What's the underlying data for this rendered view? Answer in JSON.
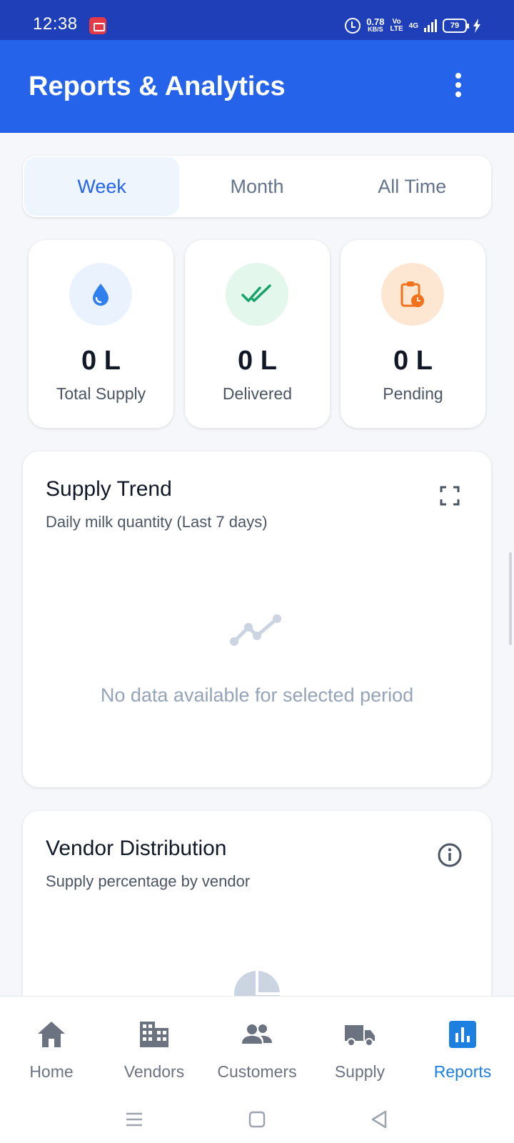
{
  "status_bar": {
    "time": "12:38",
    "speed_value": "0.78",
    "speed_unit": "KB/S",
    "volte_top": "Vo",
    "volte_bottom": "LTE",
    "network": "4G",
    "battery": "79"
  },
  "app_bar": {
    "title": "Reports & Analytics",
    "menu_icon": "more-vert-icon"
  },
  "period_tabs": {
    "items": [
      "Week",
      "Month",
      "All Time"
    ],
    "selected": "Week"
  },
  "stats": [
    {
      "icon": "water-drop-icon",
      "value": "0 L",
      "label": "Total Supply",
      "icon_bg": "#eaf2fd",
      "icon_color": "#2f80ed"
    },
    {
      "icon": "double-check-icon",
      "value": "0 L",
      "label": "Delivered",
      "icon_bg": "#e3f7ec",
      "icon_color": "#16a36a"
    },
    {
      "icon": "clipboard-clock-icon",
      "value": "0 L",
      "label": "Pending",
      "icon_bg": "#fde7d3",
      "icon_color": "#f2711c"
    }
  ],
  "supply_trend": {
    "title": "Supply Trend",
    "subtitle": "Daily milk quantity (Last 7 days)",
    "action_icon": "fullscreen-icon",
    "empty_icon": "line-chart-icon",
    "empty_text": "No data available for selected period"
  },
  "vendor_distribution": {
    "title": "Vendor Distribution",
    "subtitle": "Supply percentage by vendor",
    "action_icon": "info-icon",
    "empty_icon": "pie-chart-icon"
  },
  "bottom_nav": {
    "items": [
      {
        "label": "Home",
        "icon": "home-icon"
      },
      {
        "label": "Vendors",
        "icon": "building-icon"
      },
      {
        "label": "Customers",
        "icon": "people-icon"
      },
      {
        "label": "Supply",
        "icon": "truck-icon"
      },
      {
        "label": "Reports",
        "icon": "bar-chart-icon"
      }
    ],
    "active": "Reports"
  },
  "colors": {
    "primary": "#2563eb",
    "status_bar": "#1f3fb8",
    "active_nav": "#1d7fe0",
    "muted_text": "#94a3b8"
  }
}
